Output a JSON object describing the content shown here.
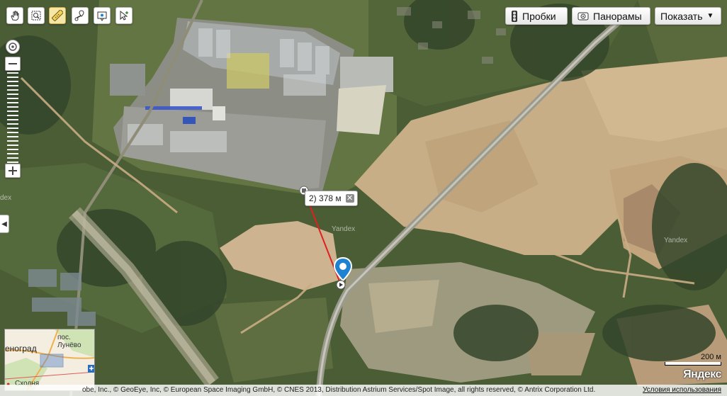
{
  "toolbar": {
    "tools": [
      {
        "name": "hand-icon"
      },
      {
        "name": "magnifier-icon"
      },
      {
        "name": "ruler-icon",
        "active": true
      },
      {
        "name": "route-icon"
      },
      {
        "name": "placemark-icon"
      },
      {
        "name": "cursor-icon"
      }
    ],
    "traffic_label": "Пробки",
    "panoramas_label": "Панорамы",
    "show_label": "Показать"
  },
  "measure": {
    "point_number": "2)",
    "distance": "378 м",
    "remove_label": "✕"
  },
  "minimap": {
    "city_label": "еноград",
    "village_label_1": "пос.",
    "village_label_2": "Лунёво",
    "station_label": "Сходня"
  },
  "scale": {
    "label": "200 м"
  },
  "logo": "Яндекс",
  "copyright": {
    "text": "obe, Inc., © GeoEye, Inc, © European Space Imaging GmbH, © CNES 2013, Distribution Astrium Services/Spot Image, all rights reserved, © Antrix Corporation Ltd.",
    "terms": "Условия использования"
  },
  "watermarks": [
    "Yandex",
    "Yandex",
    "dex"
  ],
  "colors": {
    "accent_measure_line": "#e02020",
    "placemark": "#1e82d2",
    "highway": "#9a9a8e"
  }
}
